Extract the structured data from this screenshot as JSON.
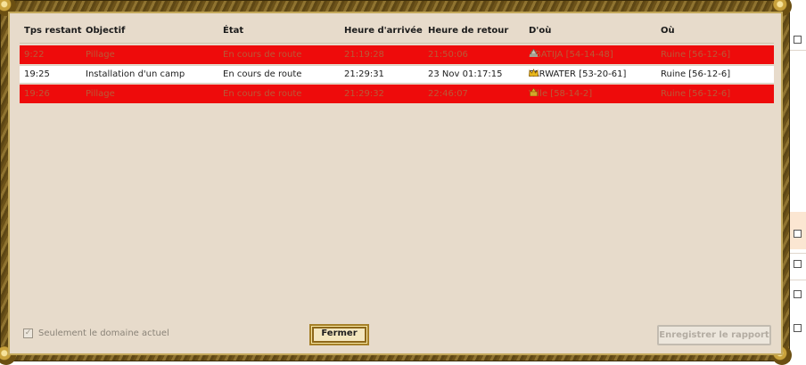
{
  "table": {
    "headers": [
      "Tps restant",
      "Objectif",
      "État",
      "Heure d'arrivée",
      "Heure de retour",
      "D'où",
      "Où"
    ],
    "rows": [
      {
        "remaining": "9:22",
        "objective": "Pillage",
        "state": "En cours de route",
        "arrival": "21:19:28",
        "return": "21:50:06",
        "origin_icon": "tower-icon",
        "origin": "ABATIJA [54-14-48]",
        "destination": "Ruine [56-12-6]",
        "highlight": "red"
      },
      {
        "remaining": "19:25",
        "objective": "Installation d'un camp",
        "state": "En cours de route",
        "arrival": "21:29:31",
        "return": "23 Nov 01:17:15",
        "origin_icon": "crown-icon",
        "origin": "FARWATER [53-20-61]",
        "destination": "Ruine [56-12-6]",
        "highlight": "none"
      },
      {
        "remaining": "19:26",
        "objective": "Pillage",
        "state": "En cours de route",
        "arrival": "21:29:32",
        "return": "22:46:07",
        "origin_icon": "castle-icon",
        "origin": "Ville [58-14-2]",
        "destination": "Ruine [56-12-6]",
        "highlight": "red"
      }
    ]
  },
  "footer": {
    "only_current_domain_label": "Seulement le domaine actuel",
    "only_current_domain_checked": true,
    "close_label": "Fermer",
    "save_report_label": "Enregistrer le rapport",
    "save_report_enabled": false
  },
  "colors": {
    "highlight_row": "#ee0b0b",
    "panel_background": "#e7dbcb",
    "frame_gold": "#c3a85b"
  }
}
